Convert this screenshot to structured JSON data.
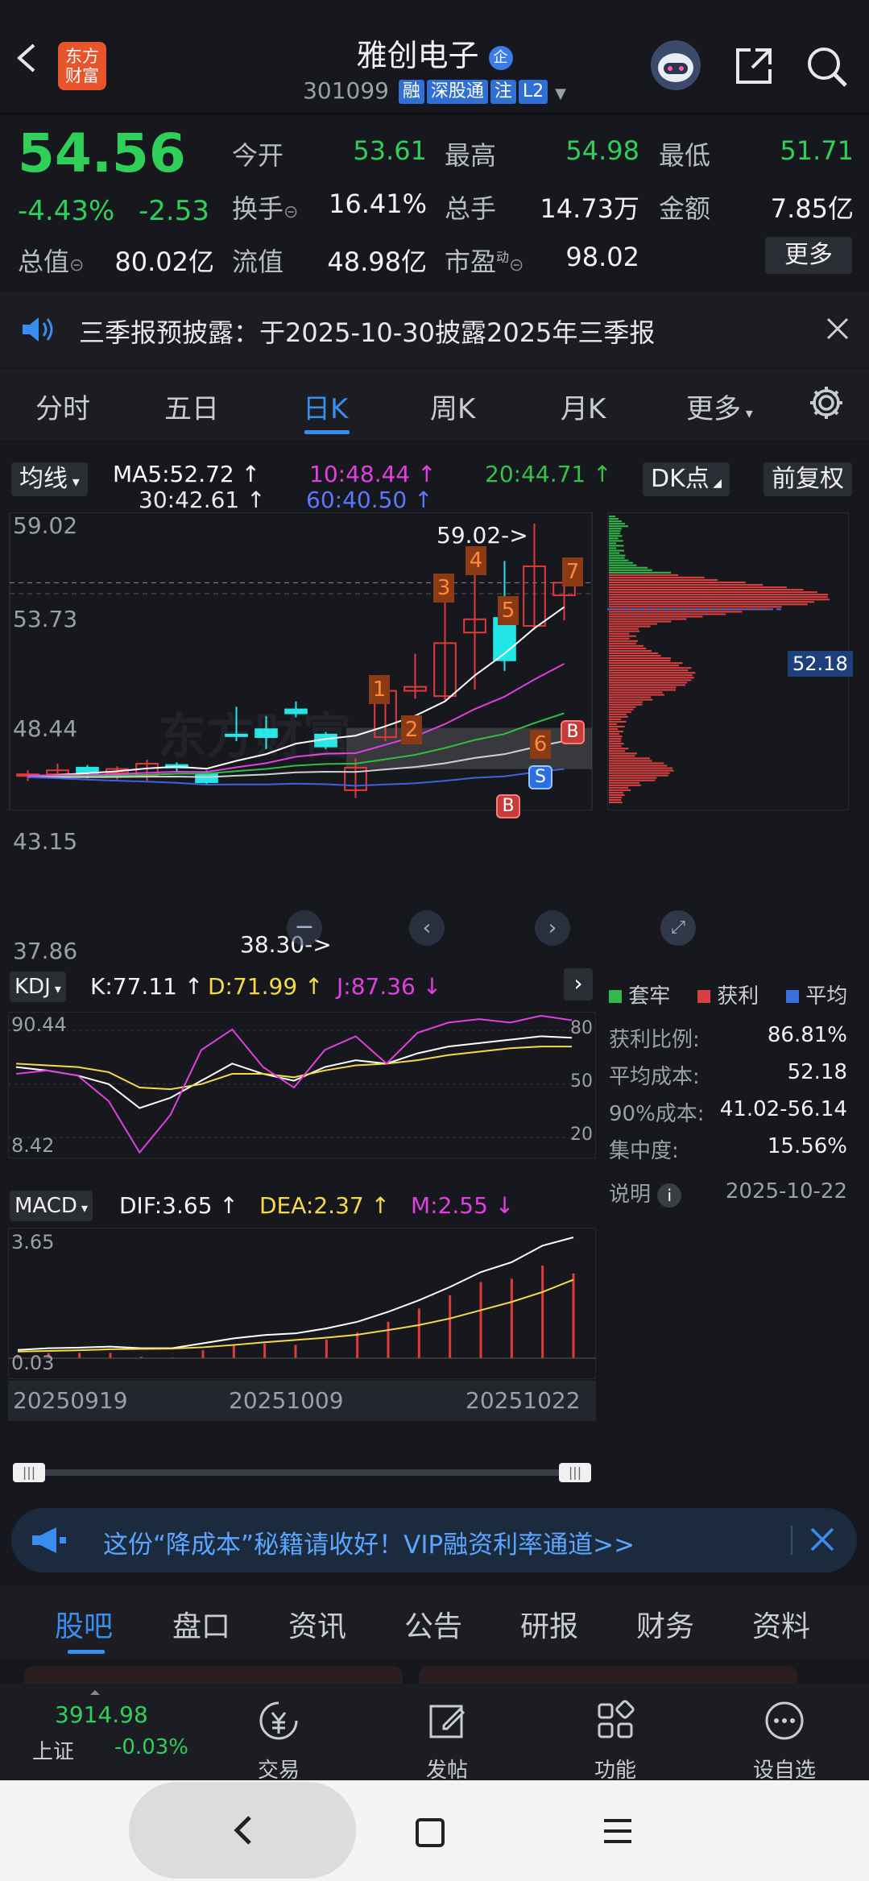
{
  "header": {
    "stock_name": "雅创电子",
    "stock_code": "301099",
    "logo_line1": "东方",
    "logo_line2": "财富",
    "badges": [
      "融",
      "深股通",
      "注",
      "L2"
    ]
  },
  "quote": {
    "price": "54.56",
    "change_pct": "-4.43%",
    "change": "-2.53",
    "open_label": "今开",
    "open": "53.61",
    "high_label": "最高",
    "high": "54.98",
    "low_label": "最低",
    "low": "51.71",
    "turnover_label": "换手",
    "turnover": "16.41%",
    "volume_label": "总手",
    "volume": "14.73万",
    "amount_label": "金额",
    "amount": "7.85亿",
    "mktcap_label": "总值",
    "mktcap": "80.02亿",
    "float_label": "流值",
    "float_cap": "48.98亿",
    "pe_label": "市盈",
    "pe_sup": "动",
    "pe": "98.02",
    "more_button": "更多"
  },
  "notice": {
    "text": "三季报预披露：于2025-10-30披露2025年三季报"
  },
  "period_tabs": [
    "分时",
    "五日",
    "日K",
    "周K",
    "月K",
    "更多"
  ],
  "active_period_tab": "日K",
  "ma": {
    "selector": "均线",
    "ma5": "MA5:52.72",
    "ma10": "10:48.44",
    "ma20": "20:44.71",
    "ma30": "30:42.61",
    "ma60": "60:40.50",
    "dk_button": "DK点",
    "adjust_button": "前复权"
  },
  "kline": {
    "y_labels": [
      "59.02",
      "53.73",
      "48.44",
      "43.15",
      "37.86"
    ],
    "max_marker": "59.02->",
    "min_marker": "38.30->",
    "watermark": "东方财富",
    "chip_numbers": [
      "1",
      "2",
      "3",
      "4",
      "5",
      "6",
      "7"
    ],
    "signals": [
      "B",
      "S",
      "B"
    ],
    "avg_cost_tag": "52.18"
  },
  "chart_data": {
    "type": "candlestick",
    "x_labels": [
      "20250919",
      "20251009",
      "20251022"
    ],
    "ylim": [
      37.86,
      59.02
    ],
    "candles": [
      {
        "o": 40.0,
        "c": 40.1,
        "h": 40.4,
        "l": 39.6
      },
      {
        "o": 40.1,
        "c": 40.4,
        "h": 40.9,
        "l": 39.8
      },
      {
        "o": 40.6,
        "c": 40.2,
        "h": 40.8,
        "l": 39.8
      },
      {
        "o": 40.2,
        "c": 40.5,
        "h": 40.7,
        "l": 39.7
      },
      {
        "o": 40.0,
        "c": 40.9,
        "h": 41.2,
        "l": 39.6
      },
      {
        "o": 40.8,
        "c": 40.6,
        "h": 41.0,
        "l": 40.3
      },
      {
        "o": 40.1,
        "c": 39.5,
        "h": 40.4,
        "l": 39.3
      },
      {
        "o": 43.1,
        "c": 43.0,
        "h": 45.2,
        "l": 42.6
      },
      {
        "o": 43.5,
        "c": 42.9,
        "h": 44.5,
        "l": 42.0
      },
      {
        "o": 45.0,
        "c": 44.7,
        "h": 45.6,
        "l": 44.4
      },
      {
        "o": 43.1,
        "c": 42.2,
        "h": 43.3,
        "l": 42.0
      },
      {
        "o": 38.9,
        "c": 40.6,
        "h": 41.3,
        "l": 38.3
      },
      {
        "o": 42.9,
        "c": 46.4,
        "h": 47.6,
        "l": 42.6
      },
      {
        "o": 46.4,
        "c": 46.7,
        "h": 49.2,
        "l": 45.8
      },
      {
        "o": 46.0,
        "c": 50.0,
        "h": 53.7,
        "l": 45.7
      },
      {
        "o": 50.8,
        "c": 51.8,
        "h": 55.4,
        "l": 46.5
      },
      {
        "o": 51.9,
        "c": 48.7,
        "h": 56.2,
        "l": 47.9
      },
      {
        "o": 51.3,
        "c": 55.8,
        "h": 59.02,
        "l": 51.0
      },
      {
        "o": 53.61,
        "c": 54.56,
        "h": 54.98,
        "l": 51.71
      }
    ],
    "ma_lines": [
      {
        "name": "MA5",
        "color": "#ffffff",
        "last": 52.72
      },
      {
        "name": "MA10",
        "color": "#e040e0",
        "last": 48.44
      },
      {
        "name": "MA20",
        "color": "#30c040",
        "last": 44.71
      },
      {
        "name": "MA30",
        "color": "#d0d0d0",
        "last": 42.61
      },
      {
        "name": "MA60",
        "color": "#4060e0",
        "last": 40.5
      }
    ],
    "kdj": {
      "K": 77.11,
      "D": 71.99,
      "J": 87.36,
      "ylim": [
        8.42,
        90.44
      ]
    },
    "macd": {
      "DIF": 3.65,
      "DEA": 2.37,
      "M": 2.55,
      "ylim": [
        0.03,
        3.65
      ]
    }
  },
  "kdj": {
    "selector": "KDJ",
    "k": "K:77.11",
    "d": "D:71.99",
    "j": "J:87.36",
    "y_top": "90.44",
    "y_bottom": "8.42",
    "ref80": "80",
    "ref50": "50",
    "ref20": "20"
  },
  "macd": {
    "selector": "MACD",
    "dif": "DIF:3.65",
    "dea": "DEA:2.37",
    "m": "M:2.55",
    "y_top": "3.65",
    "y_bottom": "0.03"
  },
  "x_axis": {
    "d1": "20250919",
    "d2": "20251009",
    "d3": "20251022"
  },
  "chip_dist": {
    "legend_trapped": "套牢",
    "legend_profit": "获利",
    "legend_avg": "平均",
    "profit_ratio_label": "获利比例:",
    "profit_ratio": "86.81%",
    "avg_cost_label": "平均成本:",
    "avg_cost": "52.18",
    "cost90_label": "90%成本:",
    "cost90": "41.02-56.14",
    "concentration_label": "集中度:",
    "concentration": "15.56%",
    "explain_label": "说明",
    "date": "2025-10-22"
  },
  "ad_banner": {
    "text": "这份“降成本”秘籍请收好！VIP融资利率通道>>"
  },
  "bottom_tabs": [
    "股吧",
    "盘口",
    "资讯",
    "公告",
    "研报",
    "财务",
    "资料"
  ],
  "toolbar": {
    "index_value": "3914.98",
    "index_name": "上证",
    "index_change": "-0.03%",
    "items": [
      "交易",
      "发帖",
      "功能",
      "设自选"
    ]
  },
  "colors": {
    "up": "#ef4a44",
    "down": "#2fd05a",
    "flat_candle": "#22e6e6",
    "accent": "#3a8df0"
  }
}
